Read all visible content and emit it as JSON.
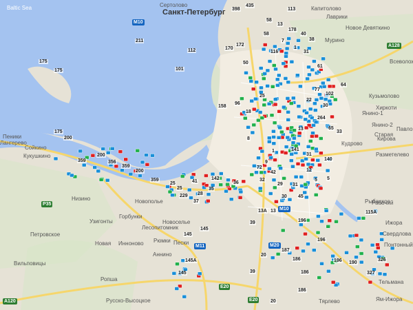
{
  "water_labels": [
    "Baltic Sea"
  ],
  "city_labels": [
    "Санкт-Петербург"
  ],
  "place_labels": [
    "Капитолово",
    "Лаврики",
    "Новое Девяткино",
    "Мурино",
    "Всеволожск",
    "Кудрово",
    "Кузьмолово",
    "Кирова",
    "Разметелево",
    "Павлово",
    "Старая",
    "Янино-1",
    "Хиркоти",
    "Янино-2",
    "Сертолово",
    "Пеники",
    "Сойкино",
    "Кукушкино",
    "Лангерево",
    "Низино",
    "Новополье",
    "Горбунки",
    "Узигонты",
    "Петровское",
    "Инноново",
    "Новая",
    "Ропша",
    "Вильповицы",
    "Русско-Высоцкое",
    "Лесопитомник",
    "Рюмки",
    "Пески",
    "Аннино",
    "Новосельe",
    "Рыбацкое",
    "Ижора",
    "Свердлова",
    "Понтонный",
    "Тельмана",
    "Ям-Ижора",
    "Тярлево",
    "Рабочий"
  ],
  "highway_labels": [
    "M10",
    "A128",
    "P35",
    "A120",
    "M11",
    "M20",
    "E20",
    "M10",
    "E20"
  ],
  "route_labels": [
    "398",
    "435",
    "58",
    "13",
    "113",
    "211",
    "112",
    "101",
    "178",
    "175",
    "175",
    "170",
    "172",
    "40",
    "7",
    "38",
    "58",
    "31",
    "1",
    "61",
    "50",
    "25",
    "158",
    "96",
    "18",
    "8",
    "64",
    "102",
    "77",
    "22",
    "30",
    "264",
    "65",
    "33",
    "175",
    "200",
    "200",
    "356",
    "359",
    "359",
    "200",
    "359",
    "25",
    "25",
    "41",
    "142",
    "28",
    "36",
    "72",
    "32",
    "9",
    "1",
    "141",
    "140",
    "31",
    "12",
    "5",
    "5",
    "229",
    "145",
    "145",
    "39",
    "13A",
    "13",
    "30",
    "29",
    "31",
    "45",
    "196",
    "115A",
    "196",
    "187",
    "186",
    "190",
    "196",
    "326",
    "327",
    "145A",
    "145",
    "39",
    "20",
    "186",
    "186",
    "20",
    "13",
    "42",
    "116",
    "37",
    "35"
  ]
}
